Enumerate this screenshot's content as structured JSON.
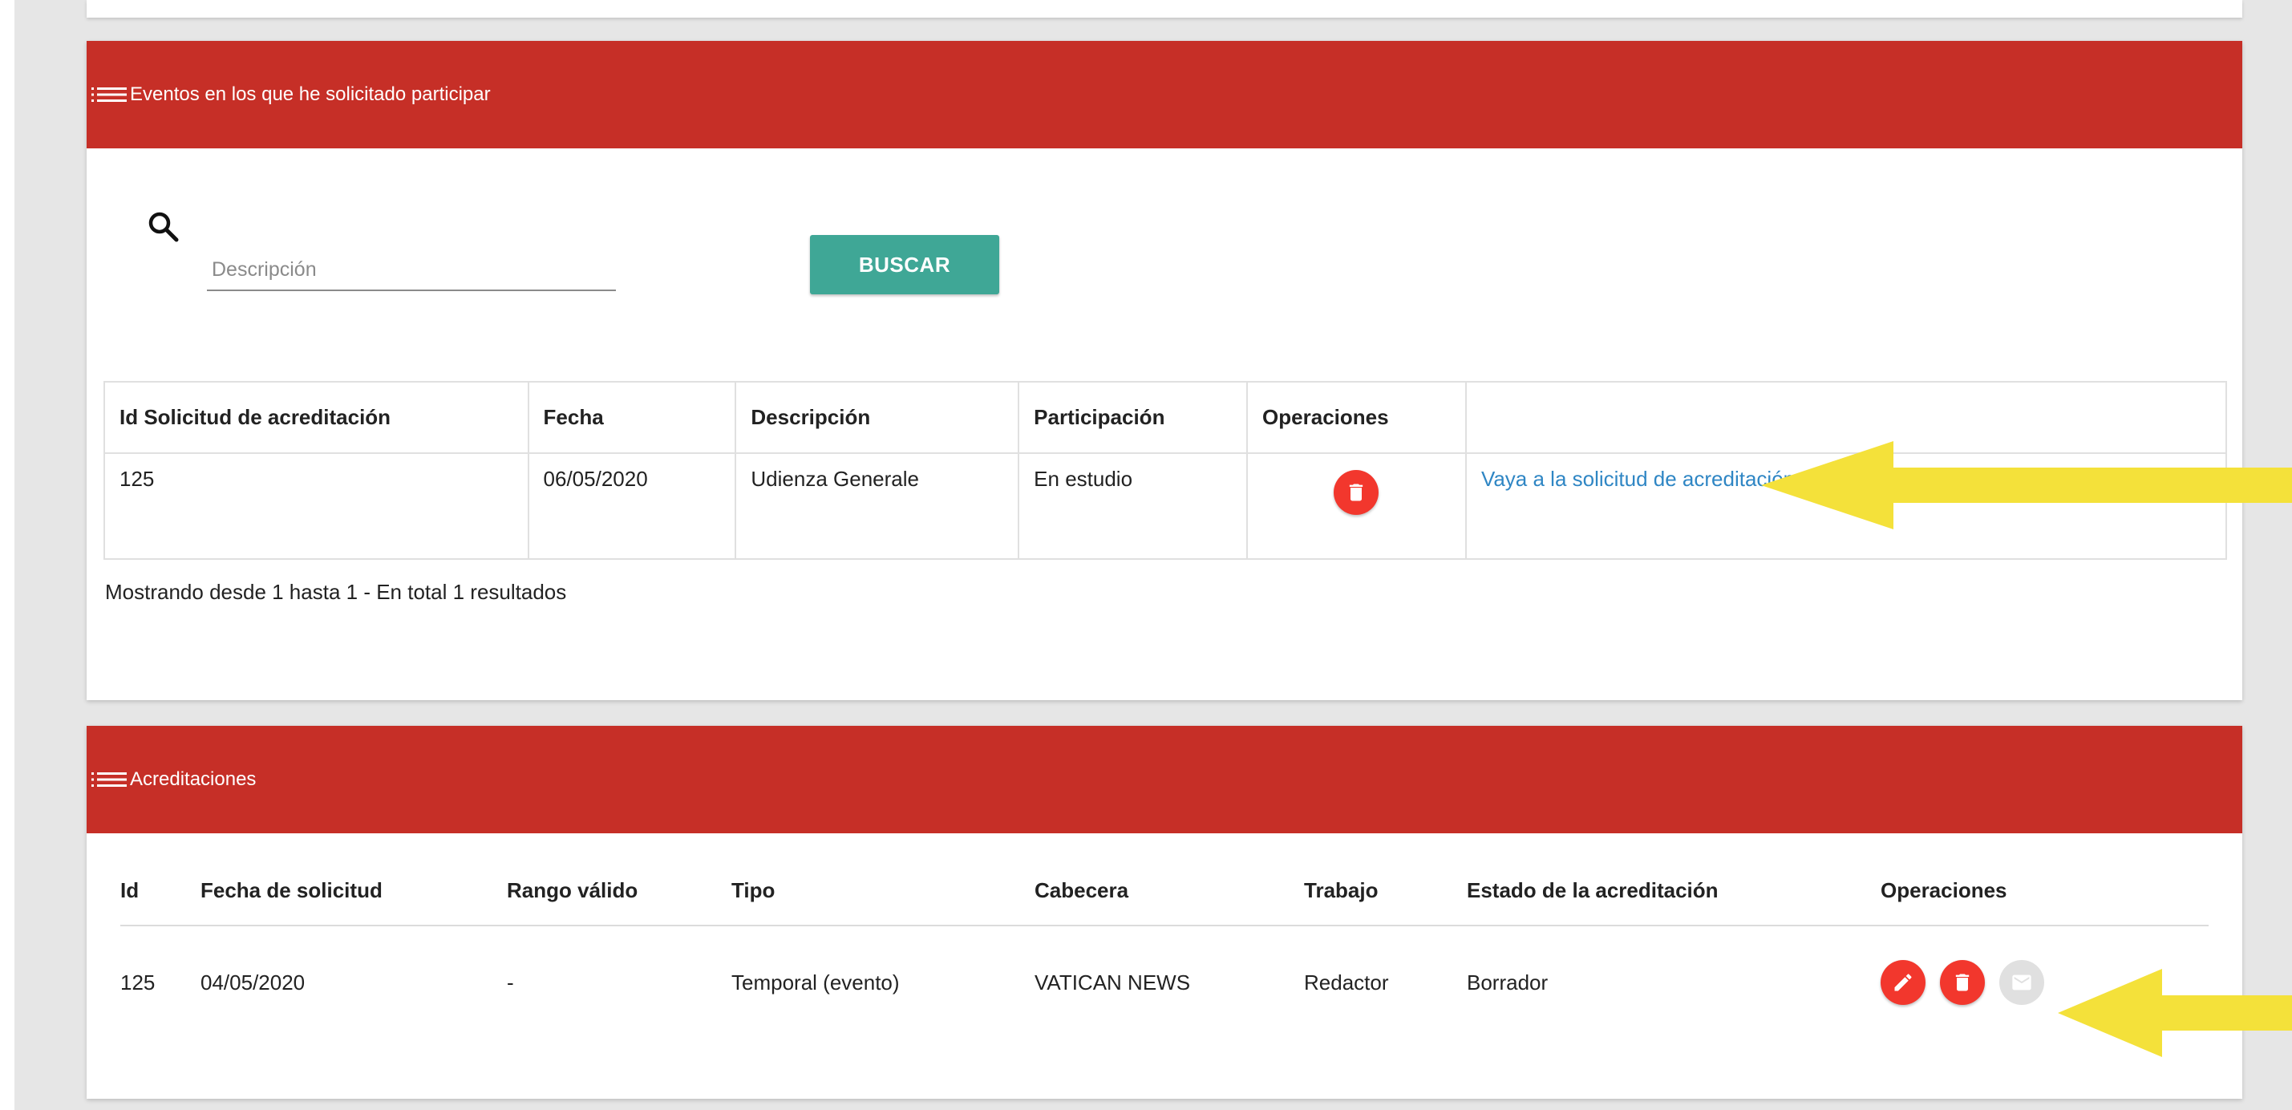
{
  "colors": {
    "header": "#c62f27",
    "button_teal": "#3fa796",
    "action_red": "#f2372d",
    "link_blue": "#2f86c4",
    "arrow_yellow": "#f4e13a"
  },
  "events_card": {
    "title": "Eventos en los que he solicitado participar",
    "search": {
      "placeholder": "Descripción",
      "value": "",
      "button_label": "BUSCAR"
    },
    "table": {
      "columns": [
        "Id Solicitud de acreditación",
        "Fecha",
        "Descripción",
        "Participación",
        "Operaciones",
        ""
      ],
      "rows": [
        {
          "id": "125",
          "fecha": "06/05/2020",
          "descripcion": "Udienza Generale",
          "participacion": "En estudio",
          "link_text": "Vaya a la solicitud de acreditación correspondiente"
        }
      ]
    },
    "pagination_text": "Mostrando desde 1 hasta 1 - En total 1 resultados"
  },
  "accreditations_card": {
    "title": "Acreditaciones",
    "table": {
      "columns": [
        "Id",
        "Fecha de solicitud",
        "Rango válido",
        "Tipo",
        "Cabecera",
        "Trabajo",
        "Estado de la acreditación",
        "Operaciones"
      ],
      "rows": [
        {
          "id": "125",
          "fecha_solicitud": "04/05/2020",
          "rango_valido": "-",
          "tipo": "Temporal (evento)",
          "cabecera": "VATICAN NEWS",
          "trabajo": "Redactor",
          "estado": "Borrador"
        }
      ]
    }
  },
  "icons": [
    "list-icon",
    "search-icon",
    "trash-icon",
    "pencil-icon",
    "email-icon",
    "arrow-icon"
  ]
}
